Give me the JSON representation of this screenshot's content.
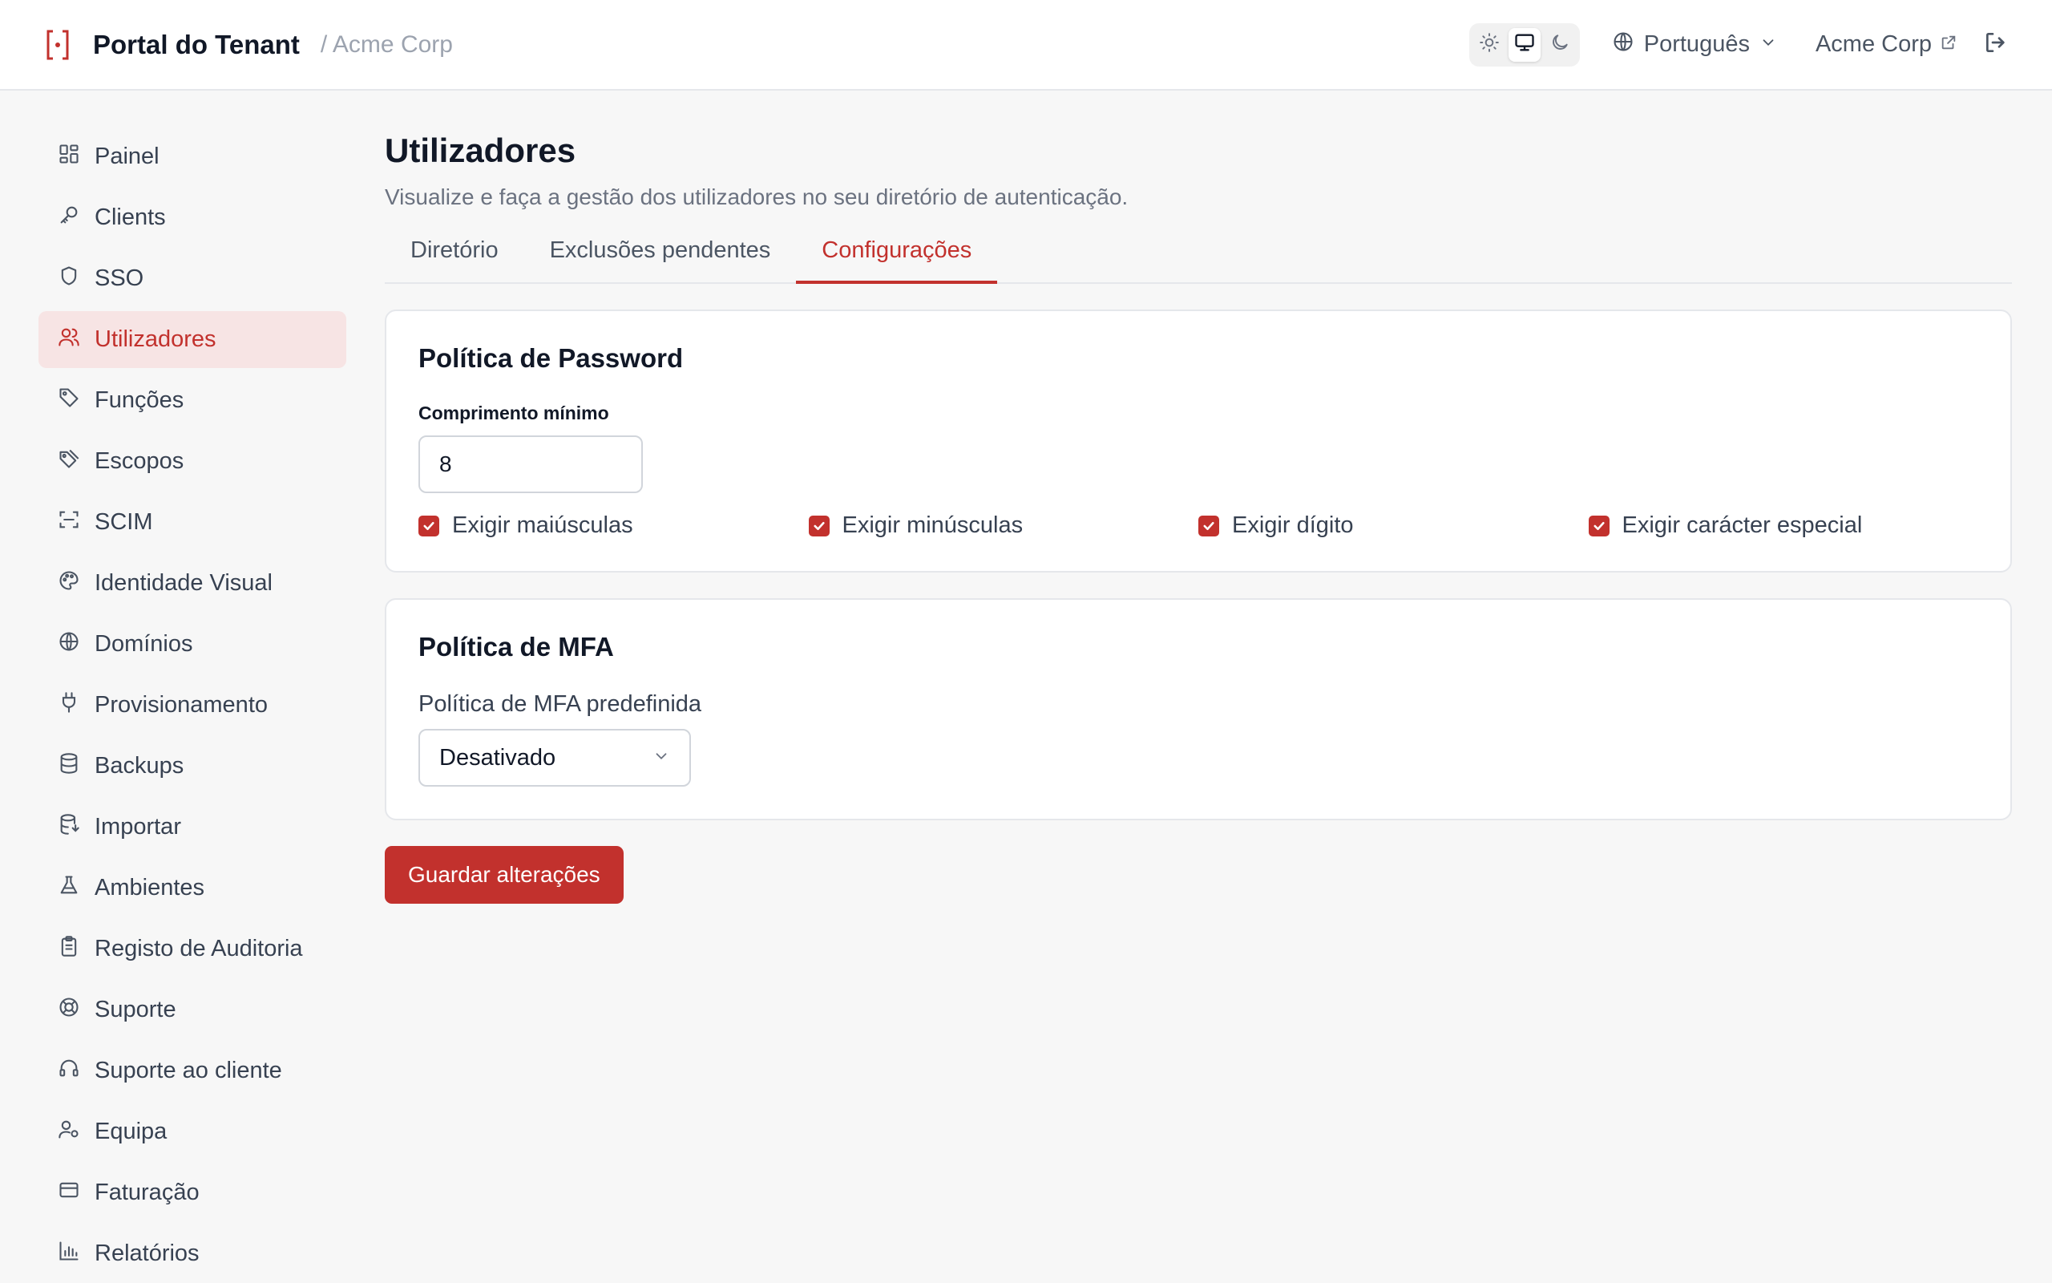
{
  "header": {
    "title": "Portal do Tenant",
    "breadcrumb": "/ Acme Corp",
    "theme_options": [
      "light",
      "system",
      "dark"
    ],
    "theme_selected": "system",
    "language": "Português",
    "tenant_link": "Acme Corp"
  },
  "sidebar": {
    "active_item": "Utilizadores",
    "items": [
      {
        "label": "Painel",
        "icon": "dashboard-icon"
      },
      {
        "label": "Clients",
        "icon": "key-icon"
      },
      {
        "label": "SSO",
        "icon": "shield-icon"
      },
      {
        "label": "Utilizadores",
        "icon": "users-icon"
      },
      {
        "label": "Funções",
        "icon": "tag-icon"
      },
      {
        "label": "Escopos",
        "icon": "tags-icon"
      },
      {
        "label": "SCIM",
        "icon": "scan-icon"
      },
      {
        "label": "Identidade Visual",
        "icon": "palette-icon"
      },
      {
        "label": "Domínios",
        "icon": "globe-icon"
      },
      {
        "label": "Provisionamento",
        "icon": "plug-icon"
      },
      {
        "label": "Backups",
        "icon": "database-icon"
      },
      {
        "label": "Importar",
        "icon": "database-import-icon"
      },
      {
        "label": "Ambientes",
        "icon": "flask-icon"
      },
      {
        "label": "Registo de Auditoria",
        "icon": "clipboard-icon"
      },
      {
        "label": "Suporte",
        "icon": "lifebuoy-icon"
      },
      {
        "label": "Suporte ao cliente",
        "icon": "headset-icon"
      },
      {
        "label": "Equipa",
        "icon": "user-cog-icon"
      },
      {
        "label": "Faturação",
        "icon": "credit-card-icon"
      },
      {
        "label": "Relatórios",
        "icon": "bar-chart-icon"
      }
    ]
  },
  "main": {
    "title": "Utilizadores",
    "subtitle": "Visualize e faça a gestão dos utilizadores no seu diretório de autenticação.",
    "tabs": [
      {
        "label": "Diretório"
      },
      {
        "label": "Exclusões pendentes"
      },
      {
        "label": "Configurações"
      }
    ],
    "active_tab": "Configurações",
    "password_policy": {
      "title": "Política de Password",
      "min_length_label": "Comprimento mínimo",
      "min_length_value": "8",
      "checks": [
        {
          "label": "Exigir maiúsculas",
          "checked": true
        },
        {
          "label": "Exigir minúsculas",
          "checked": true
        },
        {
          "label": "Exigir dígito",
          "checked": true
        },
        {
          "label": "Exigir carácter especial",
          "checked": true
        }
      ]
    },
    "mfa_policy": {
      "title": "Política de MFA",
      "default_label": "Política de MFA predefinida",
      "default_value": "Desativado"
    },
    "save_label": "Guardar alterações"
  },
  "colors": {
    "accent": "#c2312d",
    "active_bg": "#f7e4e4",
    "page_bg": "#f7f7f7"
  }
}
